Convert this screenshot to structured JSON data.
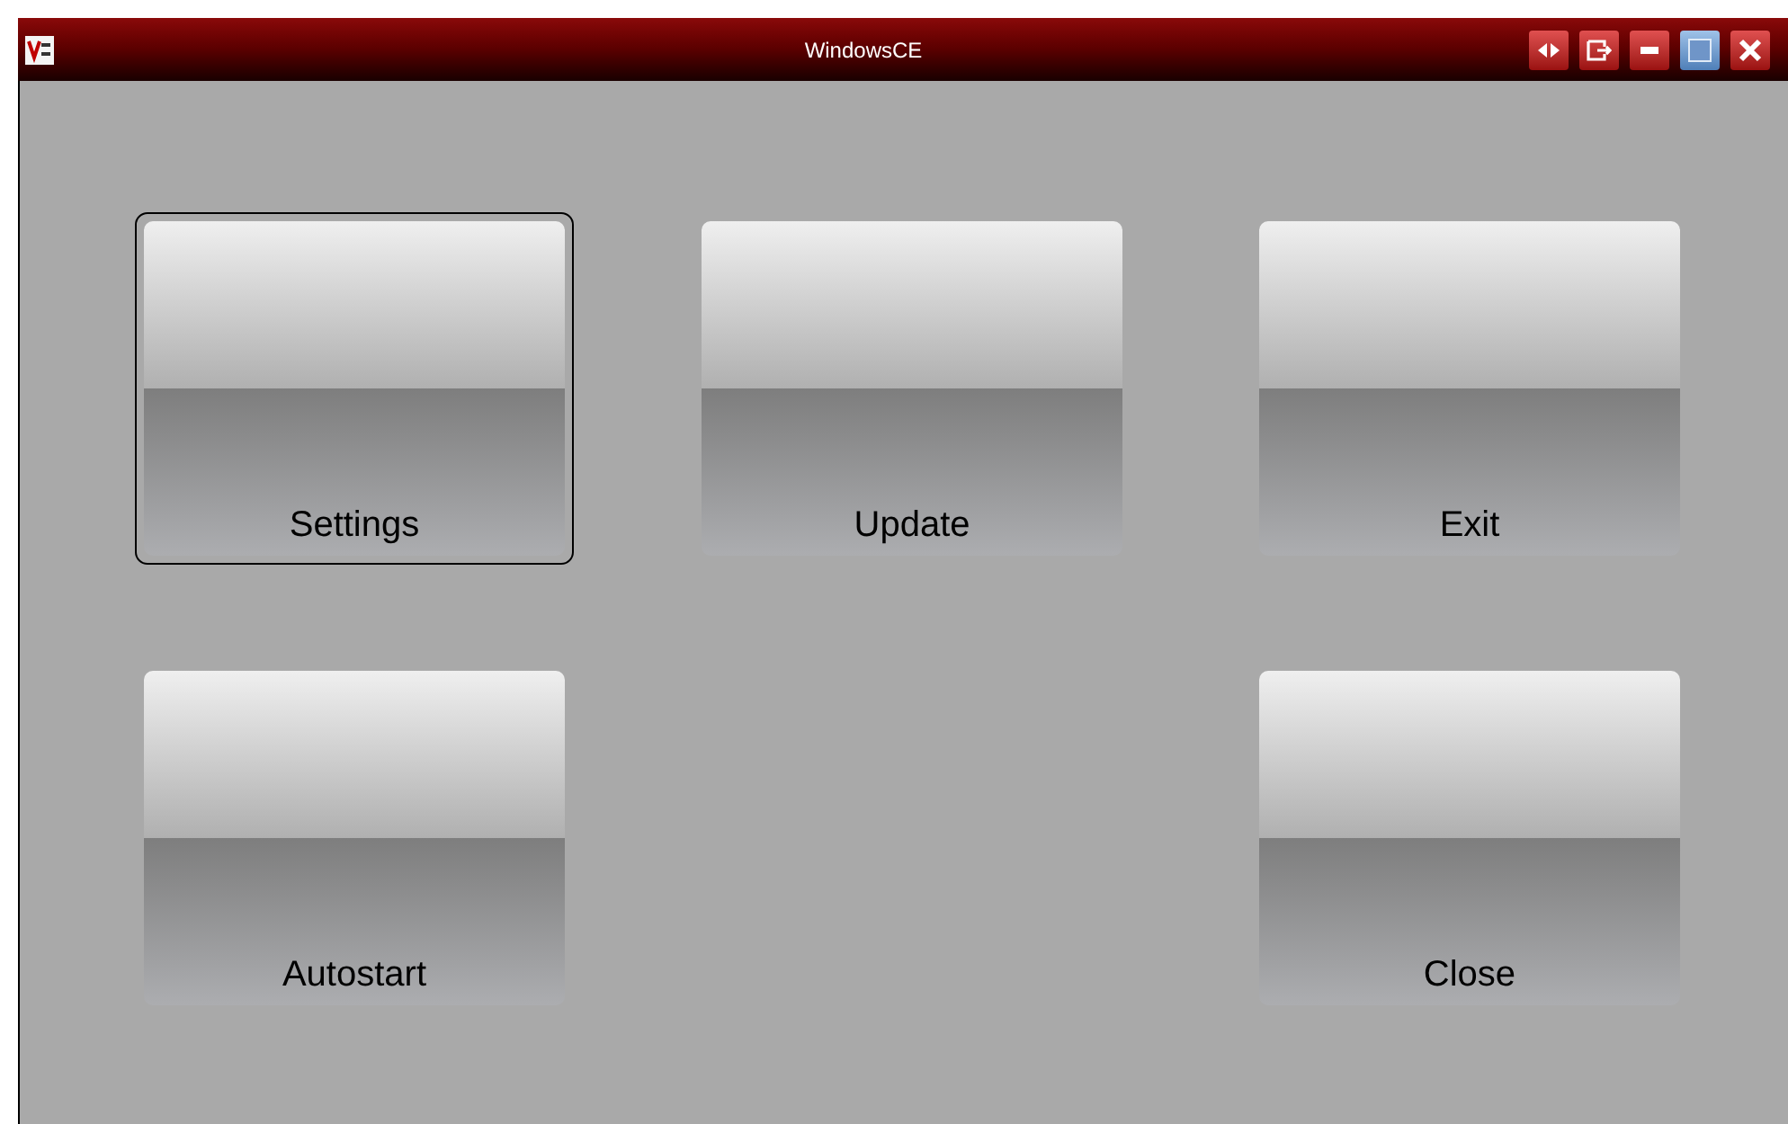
{
  "window": {
    "title": "WindowsCE"
  },
  "rows": [
    {
      "buttons": [
        {
          "kind": "button",
          "label": "Settings",
          "focused": true
        },
        {
          "kind": "button",
          "label": "Update",
          "focused": false
        },
        {
          "kind": "button",
          "label": "Exit",
          "focused": false
        }
      ]
    },
    {
      "buttons": [
        {
          "kind": "button",
          "label": "Autostart",
          "focused": false
        },
        {
          "kind": "spacer"
        },
        {
          "kind": "button",
          "label": "Close",
          "focused": false
        }
      ]
    }
  ]
}
